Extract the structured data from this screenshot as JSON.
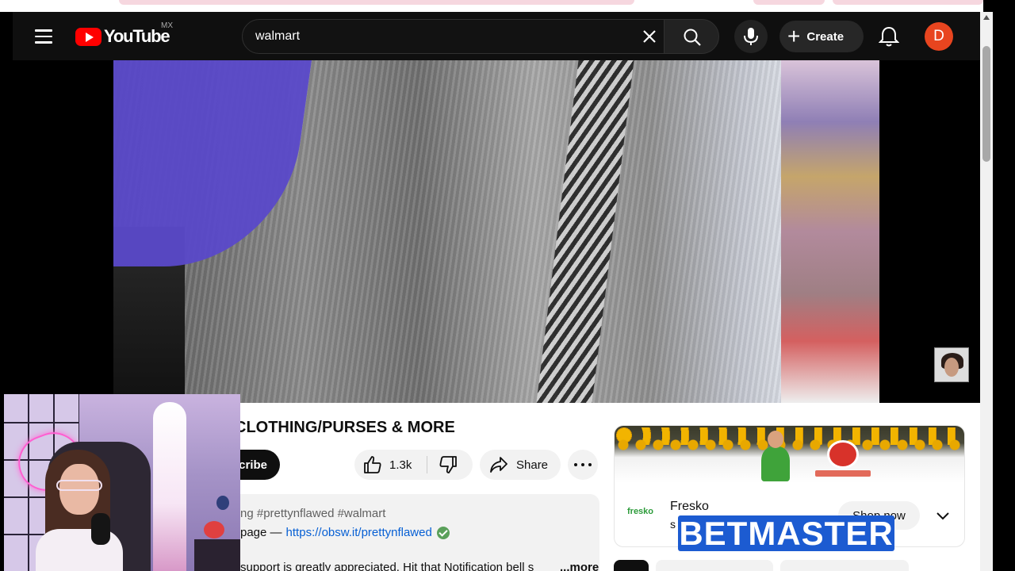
{
  "header": {
    "logo_text": "YouTube",
    "region": "MX",
    "search_value": "walmart",
    "create_label": "Create",
    "avatar_letter": "D"
  },
  "video": {
    "title_visible": "CLOTHING/PURSES & MORE",
    "subscribe_fragment": "cribe",
    "like_count": "1.3k",
    "share_label": "Share"
  },
  "description": {
    "line1": "ng #prettynflawed #walmart",
    "line2_prefix": "page —",
    "link": "https://obsw.it/prettynflawed",
    "line3": "support is greatly appreciated. Hit that Notification bell s",
    "more_label": "...more"
  },
  "ad": {
    "advertiser": "Fresko",
    "sub_fragment": "s",
    "logo_text": "fresko",
    "shop_label": "Shop now"
  },
  "overlay": {
    "betmaster_text": "BETMASTER"
  },
  "icons": [
    "menu-icon",
    "youtube-logo",
    "clear-icon",
    "search-icon",
    "mic-icon",
    "plus-icon",
    "bell-icon",
    "like-icon",
    "dislike-icon",
    "share-icon",
    "more-icon",
    "verified-icon",
    "chevron-down-icon"
  ],
  "colors": {
    "brand_red": "#ff0000",
    "header_bg": "#0f0f0f",
    "link": "#065fd4",
    "avatar_bg": "#e8451f",
    "betmaster_bg": "#1c5bd1"
  }
}
